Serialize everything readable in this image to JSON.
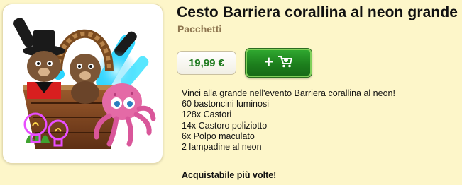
{
  "product": {
    "title": "Cesto Barriera corallina al neon grande",
    "category": "Pacchetti",
    "price": "19,99 €",
    "description_lines": [
      "Vinci alla grande nell'evento Barriera corallina al neon!",
      "60 bastoncini luminosi",
      "128x Castori",
      "14x Castoro poliziotto",
      "6x Polpo maculato",
      "2 lampadine al neon"
    ],
    "repeatable_note": "Acquistabile più volte!"
  },
  "buy_button": {
    "icon": "cart-plus-icon"
  },
  "image": {
    "icons": [
      "basket-icon",
      "beaver-icon",
      "police-beaver-icon",
      "octopus-icon",
      "neon-bulb-icon",
      "glow-stick-icon"
    ]
  },
  "colors": {
    "background": "#fdf6c9",
    "price_text": "#1e7a1e",
    "buy_button": "#1d7f1d",
    "category_text": "#8e7650"
  }
}
